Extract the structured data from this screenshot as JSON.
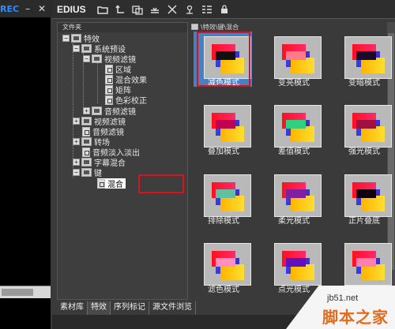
{
  "left_panel": {
    "rec_label": "REC",
    "minimize": "–",
    "close": "✕"
  },
  "app": {
    "title": "EDIUS"
  },
  "toolbar": {
    "buttons": [
      {
        "icon": "folder-icon"
      },
      {
        "icon": "up-level-icon"
      },
      {
        "icon": "new-folder-icon"
      },
      {
        "icon": "apply-effect-icon"
      },
      {
        "icon": "delete-icon"
      },
      {
        "icon": "properties-icon"
      },
      {
        "icon": "view-mode-icon"
      },
      {
        "icon": "lock-icon"
      }
    ]
  },
  "tree": {
    "header": "文件夹",
    "nodes": [
      {
        "label": "特效",
        "expander": "−",
        "icon": "folder-open-icon"
      },
      {
        "label": "系统预设",
        "expander": "−",
        "icon": "folder-open-icon"
      },
      {
        "label": "视频滤镜",
        "expander": "−",
        "icon": "folder-open-icon"
      },
      {
        "label": "区域",
        "expander": "",
        "icon": "effect-icon"
      },
      {
        "label": "混合效果",
        "expander": "",
        "icon": "effect-icon"
      },
      {
        "label": "矩阵",
        "expander": "",
        "icon": "effect-icon"
      },
      {
        "label": "色彩校正",
        "expander": "",
        "icon": "effect-icon"
      },
      {
        "label": "音频滤镜",
        "expander": "+",
        "icon": "folder-icon"
      },
      {
        "label": "视频滤镜",
        "expander": "+",
        "icon": "folder-icon"
      },
      {
        "label": "音频滤镜",
        "expander": "",
        "icon": "effect-icon"
      },
      {
        "label": "转场",
        "expander": "+",
        "icon": "folder-icon"
      },
      {
        "label": "音频淡入淡出",
        "expander": "",
        "icon": "effect-icon"
      },
      {
        "label": "字幕混合",
        "expander": "+",
        "icon": "folder-icon"
      },
      {
        "label": "键",
        "expander": "−",
        "icon": "folder-open-icon"
      },
      {
        "label": "混合",
        "expander": "",
        "icon": "effect-icon",
        "selected": true
      }
    ]
  },
  "grid": {
    "path": "\\特效\\键\\混合",
    "items": [
      {
        "label": "减色模式",
        "selected": true,
        "overlap": "#101010"
      },
      {
        "label": "变亮模式",
        "overlap": "#ff7a8a"
      },
      {
        "label": "变暗模式",
        "overlap": "#1a0a30"
      },
      {
        "label": "叠加模式",
        "overlap": "#c00050"
      },
      {
        "label": "差值模式",
        "overlap": "#30d080"
      },
      {
        "label": "强光模式",
        "overlap": "#a01040"
      },
      {
        "label": "排除模式",
        "overlap": "#60c0a0"
      },
      {
        "label": "柔光模式",
        "overlap": "#8020a0"
      },
      {
        "label": "正片叠底",
        "overlap": "#100010"
      },
      {
        "label": "滤色模式",
        "overlap": "#ff90c0"
      },
      {
        "label": "点光模式",
        "overlap": "#6010c0"
      },
      {
        "label": "",
        "overlap": "#ff80b0"
      }
    ]
  },
  "tabs": [
    "素材库",
    "特效",
    "序列标记",
    "源文件浏览"
  ],
  "active_tab": "特效",
  "watermark": {
    "site": "jb51.net",
    "name": "脚本之家"
  },
  "colors": {
    "highlight_box": "#e0101a",
    "selection": "#4a7fc0",
    "rec": "#2d8cff"
  }
}
